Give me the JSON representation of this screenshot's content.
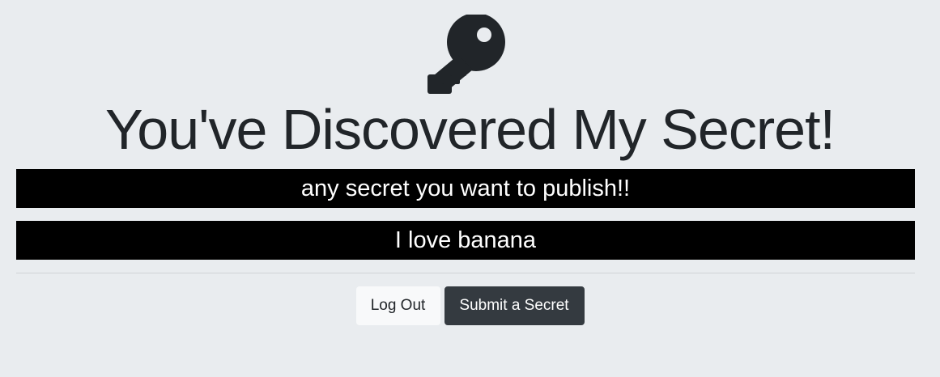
{
  "header": {
    "icon": "key-icon",
    "title": "You've Discovered My Secret!"
  },
  "secrets": [
    "any secret you want to publish!!",
    "I love banana"
  ],
  "actions": {
    "logout_label": "Log Out",
    "submit_label": "Submit a Secret"
  },
  "colors": {
    "background": "#e9ecef",
    "secret_card": "#000000",
    "secret_text": "#ffffff",
    "dark_button": "#343a40",
    "light_button": "#f8f9fa"
  }
}
